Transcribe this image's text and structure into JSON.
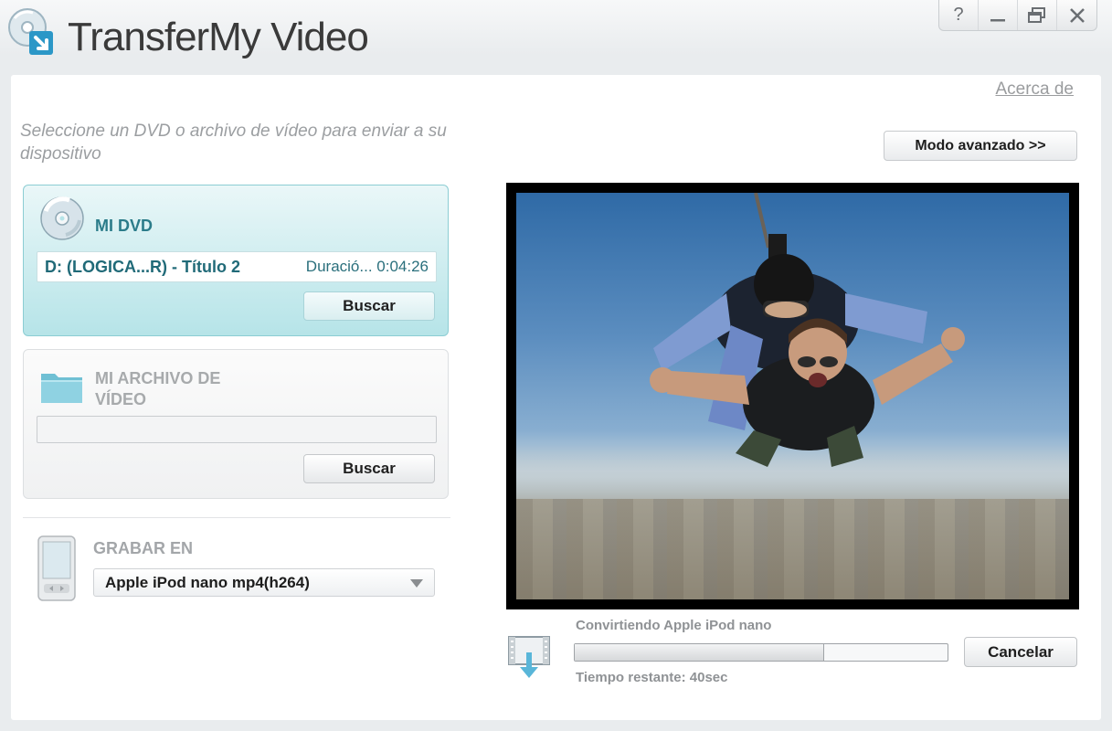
{
  "window": {
    "title": "TransferMy Video",
    "controls": {
      "help": "?",
      "minimize": "—",
      "restore": "🗗",
      "close": "X"
    }
  },
  "header": {
    "about_link": "Acerca de",
    "instructions": "Seleccione un DVD o archivo de vídeo para enviar a su dispositivo",
    "advanced_button": "Modo avanzado >>"
  },
  "dvd_panel": {
    "title": "MI DVD",
    "disc": "D:  (LOGICA...R) - Título 2",
    "duration": "Duració... 0:04:26",
    "browse_button": "Buscar"
  },
  "file_panel": {
    "title": "MI ARCHIVO DE VÍDEO",
    "path_value": "",
    "browse_button": "Buscar"
  },
  "record": {
    "label": "GRABAR EN",
    "selected_device": "Apple iPod nano mp4(h264)"
  },
  "progress": {
    "status": "Convirtiendo Apple iPod nano",
    "fraction": 0.67,
    "time_left": "Tiempo restante: 40sec",
    "cancel_button": "Cancelar"
  },
  "colors": {
    "accent": "#2b7c8a",
    "dvd_panel_bg": "#b6e4e8"
  },
  "icons": {
    "logo": "disc-arrow-logo-icon",
    "dvd": "dvd-disc-icon",
    "folder": "folder-icon",
    "device": "media-player-icon",
    "film": "film-download-icon"
  }
}
